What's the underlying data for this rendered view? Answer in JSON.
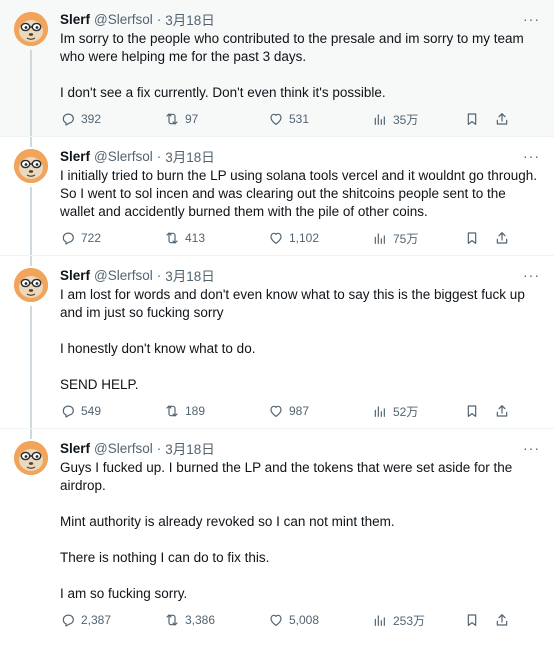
{
  "tweets": [
    {
      "name": "Slerf",
      "handle": "@Slerfsol",
      "sep": "·",
      "date": "3月18日",
      "more": "···",
      "paragraphs": [
        "Im sorry to the people who contributed to the presale and im sorry to my team who were helping me for the past 3 days.",
        "I don't see a fix currently. Don't even think it's possible."
      ],
      "replies": "392",
      "reposts": "97",
      "likes": "531",
      "views": "35万"
    },
    {
      "name": "Slerf",
      "handle": "@Slerfsol",
      "sep": "·",
      "date": "3月18日",
      "more": "···",
      "paragraphs": [
        "I initially tried to burn the LP using solana tools vercel and it wouldnt go through. So I went to sol incen and was clearing out the shitcoins people sent to the wallet and accidently burned them with the pile of other coins."
      ],
      "replies": "722",
      "reposts": "413",
      "likes": "1,102",
      "views": "75万"
    },
    {
      "name": "Slerf",
      "handle": "@Slerfsol",
      "sep": "·",
      "date": "3月18日",
      "more": "···",
      "paragraphs": [
        "I am lost for words and don't even know what to say this is the biggest fuck up and im just so fucking sorry",
        "I honestly don't know what to do.",
        "SEND HELP."
      ],
      "replies": "549",
      "reposts": "189",
      "likes": "987",
      "views": "52万"
    },
    {
      "name": "Slerf",
      "handle": "@Slerfsol",
      "sep": "·",
      "date": "3月18日",
      "more": "···",
      "paragraphs": [
        "Guys I fucked up. I burned the LP and the tokens that were set aside for the airdrop.",
        "Mint authority is already revoked so I can not mint them.",
        "There is nothing I can do to fix this.",
        "I am so fucking sorry."
      ],
      "replies": "2,387",
      "reposts": "3,386",
      "likes": "5,008",
      "views": "253万"
    }
  ],
  "icons": {
    "reply": "reply-icon",
    "repost": "repost-icon",
    "like": "heart-icon",
    "views": "views-icon",
    "bookmark": "bookmark-icon",
    "share": "share-icon",
    "avatar": "sloth-avatar"
  },
  "colors": {
    "text": "#0f1419",
    "muted": "#536471",
    "highlight_bg": "#f7f9f9",
    "thread_line": "#cfd9de",
    "avatar_bg": "#f1a45a"
  }
}
